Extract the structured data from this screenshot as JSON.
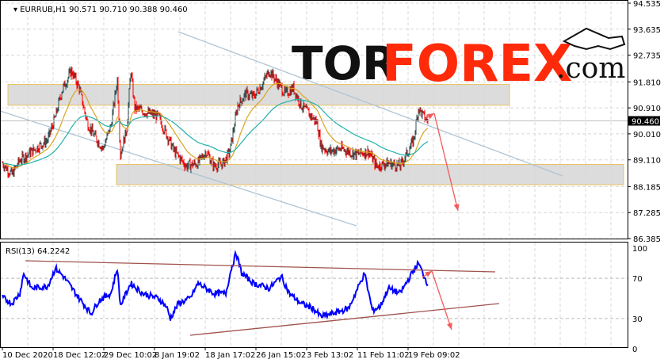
{
  "header": {
    "symbol": "EURRUB,H1",
    "ohlc": "90.571 90.710 90.388 90.460"
  },
  "logo": {
    "part1": "TOR",
    "part2": "FOREX",
    "part3": ".com"
  },
  "colors": {
    "bull": "#2f4f4f",
    "bear": "#ff0000",
    "ma_fast": "#daa520",
    "ma_slow": "#20b2aa",
    "rsi": "#0000ff",
    "arrow": "#f25a5a",
    "trend": "#a0524d",
    "channel": "#b0c4d4",
    "zone_fill": "#d6d6d6",
    "zone_border": "#e8c060"
  },
  "chart_data": {
    "type": "candlestick",
    "title": "EURRUB,H1",
    "price_ticks": [
      "94.535",
      "93.635",
      "92.735",
      "91.810",
      "90.910",
      "90.010",
      "89.110",
      "88.185",
      "87.285",
      "86.385"
    ],
    "ylim": [
      86.385,
      94.535
    ],
    "current_price": "90.460",
    "time_labels": [
      "10 Dec 2020",
      "18 Dec 12:02",
      "29 Dec 10:02",
      "8 Jan 19:02",
      "18 Jan 17:02",
      "26 Jan 15:02",
      "3 Feb 13:02",
      "11 Feb 11:02",
      "19 Feb 09:02"
    ],
    "price_path": [
      [
        0,
        89.0
      ],
      [
        12,
        88.6
      ],
      [
        22,
        89.1
      ],
      [
        32,
        89.3
      ],
      [
        42,
        89.5
      ],
      [
        57,
        89.8
      ],
      [
        67,
        90.6
      ],
      [
        75,
        91.5
      ],
      [
        87,
        92.2
      ],
      [
        97,
        91.6
      ],
      [
        107,
        90.4
      ],
      [
        117,
        89.9
      ],
      [
        127,
        89.5
      ],
      [
        137,
        90.3
      ],
      [
        145,
        91.9
      ],
      [
        149,
        89.3
      ],
      [
        157,
        90.2
      ],
      [
        162,
        92.2
      ],
      [
        167,
        90.9
      ],
      [
        177,
        90.8
      ],
      [
        197,
        90.6
      ],
      [
        207,
        90.0
      ],
      [
        217,
        89.4
      ],
      [
        232,
        88.9
      ],
      [
        247,
        89.0
      ],
      [
        257,
        89.4
      ],
      [
        267,
        88.9
      ],
      [
        279,
        89.0
      ],
      [
        287,
        89.4
      ],
      [
        297,
        91.0
      ],
      [
        307,
        91.4
      ],
      [
        317,
        91.3
      ],
      [
        327,
        91.7
      ],
      [
        337,
        92.2
      ],
      [
        347,
        91.8
      ],
      [
        357,
        91.4
      ],
      [
        367,
        91.6
      ],
      [
        377,
        91.0
      ],
      [
        387,
        90.7
      ],
      [
        397,
        90.4
      ],
      [
        402,
        89.6
      ],
      [
        412,
        89.4
      ],
      [
        427,
        89.5
      ],
      [
        447,
        89.3
      ],
      [
        462,
        89.4
      ],
      [
        472,
        88.9
      ],
      [
        487,
        89.0
      ],
      [
        502,
        88.9
      ],
      [
        512,
        89.4
      ],
      [
        519,
        89.8
      ],
      [
        525,
        90.9
      ],
      [
        532,
        90.6
      ],
      [
        537,
        90.46
      ]
    ],
    "zones": [
      {
        "from": 91.0,
        "to": 91.72
      },
      {
        "from": 88.25,
        "to": 88.95
      }
    ],
    "rsi": {
      "label": "RSI(13) 64.2242",
      "ticks": [
        "100",
        "70",
        "30",
        "0"
      ],
      "ylim": [
        0,
        100
      ],
      "levels": [
        70,
        30
      ],
      "path": [
        [
          2,
          50
        ],
        [
          12,
          45
        ],
        [
          22,
          55
        ],
        [
          27,
          75
        ],
        [
          37,
          60
        ],
        [
          57,
          62
        ],
        [
          67,
          80
        ],
        [
          77,
          72
        ],
        [
          97,
          50
        ],
        [
          112,
          35
        ],
        [
          122,
          48
        ],
        [
          137,
          55
        ],
        [
          145,
          80
        ],
        [
          149,
          43
        ],
        [
          162,
          65
        ],
        [
          177,
          55
        ],
        [
          197,
          50
        ],
        [
          207,
          42
        ],
        [
          212,
          30
        ],
        [
          222,
          45
        ],
        [
          237,
          50
        ],
        [
          247,
          65
        ],
        [
          267,
          55
        ],
        [
          282,
          55
        ],
        [
          289,
          80
        ],
        [
          295,
          95
        ],
        [
          302,
          75
        ],
        [
          317,
          65
        ],
        [
          337,
          60
        ],
        [
          352,
          72
        ],
        [
          362,
          55
        ],
        [
          377,
          45
        ],
        [
          392,
          40
        ],
        [
          402,
          32
        ],
        [
          417,
          35
        ],
        [
          437,
          40
        ],
        [
          457,
          75
        ],
        [
          467,
          38
        ],
        [
          477,
          42
        ],
        [
          487,
          60
        ],
        [
          502,
          55
        ],
        [
          517,
          75
        ],
        [
          525,
          85
        ],
        [
          537,
          64
        ]
      ]
    }
  }
}
